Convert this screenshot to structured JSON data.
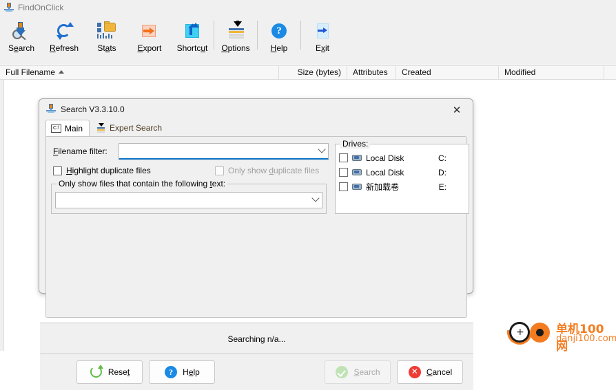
{
  "app": {
    "title": "FindOnClick",
    "icon": "pin-magnifier-icon"
  },
  "toolbar": {
    "items": [
      {
        "label_pre": "S",
        "label_key": "e",
        "label_post": "arch",
        "full": "Search",
        "icon": "search-icon"
      },
      {
        "label_pre": "",
        "label_key": "R",
        "label_post": "efresh",
        "full": "Refresh",
        "icon": "refresh-icon"
      },
      {
        "label_pre": "St",
        "label_key": "a",
        "label_post": "ts",
        "full": "Stats",
        "icon": "stats-icon"
      },
      {
        "label_pre": "",
        "label_key": "E",
        "label_post": "xport",
        "full": "Export",
        "icon": "export-icon"
      },
      {
        "label_pre": "Shortc",
        "label_key": "u",
        "label_post": "t",
        "full": "Shortcut",
        "icon": "shortcut-icon"
      },
      {
        "label_pre": "",
        "label_key": "O",
        "label_post": "ptions",
        "full": "Options",
        "icon": "options-icon"
      },
      {
        "label_pre": "",
        "label_key": "H",
        "label_post": "elp",
        "full": "Help",
        "icon": "help-icon"
      },
      {
        "label_pre": "E",
        "label_key": "x",
        "label_post": "it",
        "full": "Exit",
        "icon": "exit-icon"
      }
    ]
  },
  "list": {
    "columns": [
      {
        "label": "Full Filename",
        "sort": "asc",
        "align": "left"
      },
      {
        "label": "Size (bytes)",
        "sort": "",
        "align": "right"
      },
      {
        "label": "Attributes",
        "sort": "",
        "align": "left"
      },
      {
        "label": "Created",
        "sort": "",
        "align": "left"
      },
      {
        "label": "Modified",
        "sort": "",
        "align": "left"
      }
    ],
    "rows": []
  },
  "dialog": {
    "title": "Search V3.3.10.0",
    "icon": "pin-magnifier-icon",
    "close_label": "✕",
    "tabs": [
      {
        "label": "Main",
        "icon": "drive-letter-icon",
        "icon_text": "C:\\",
        "selected": true
      },
      {
        "label": "Expert Search",
        "icon": "expert-search-icon",
        "selected": false
      }
    ],
    "main": {
      "filename_filter": {
        "label_pre": "",
        "label_key": "F",
        "label_post": "ilename filter:",
        "full_label": "Filename filter:",
        "value": "",
        "placeholder": ""
      },
      "highlight_duplicates": {
        "label_pre": "",
        "label_key": "H",
        "label_post": "ighlight duplicate files",
        "full_label": "Highlight duplicate files",
        "checked": false,
        "disabled": false
      },
      "only_show_duplicates": {
        "label_pre": "Only show ",
        "label_key": "d",
        "label_post": "uplicate files",
        "full_label": "Only show duplicate files",
        "checked": false,
        "disabled": true
      },
      "contains_text": {
        "label_pre": "Only show files that contain the following ",
        "label_key": "t",
        "label_post": "ext:",
        "full_label": "Only show files that contain the following text:",
        "value": "",
        "placeholder": ""
      },
      "drives": {
        "title": "Drives:",
        "items": [
          {
            "name": "Local Disk",
            "letter": "C:",
            "checked": false,
            "icon": "drive-icon"
          },
          {
            "name": "Local Disk",
            "letter": "D:",
            "checked": false,
            "icon": "drive-icon"
          },
          {
            "name": "新加载卷",
            "letter": "E:",
            "checked": false,
            "icon": "drive-icon"
          }
        ]
      }
    },
    "status": "Searching n/a...",
    "buttons": [
      {
        "label_pre": "Rese",
        "label_key": "t",
        "label_post": "",
        "full": "Reset",
        "icon": "refresh-circle-icon",
        "disabled": false
      },
      {
        "label_pre": "H",
        "label_key": "e",
        "label_post": "lp",
        "full": "Help",
        "icon": "help-icon",
        "disabled": false
      },
      {
        "label_pre": "",
        "label_key": "S",
        "label_post": "earch",
        "full": "Search",
        "icon": "check-circle-icon",
        "disabled": true
      },
      {
        "label_pre": "",
        "label_key": "C",
        "label_post": "ancel",
        "full": "Cancel",
        "icon": "cancel-circle-icon",
        "disabled": false
      }
    ]
  },
  "watermark": {
    "line1": "单机100网",
    "line2": "danji100.com",
    "color": "#f47c20"
  },
  "colors": {
    "window_bg": "#f0f0f0",
    "list_bg": "#ffffff",
    "accent": "#0a6fc2",
    "title_text": "#7a7a7a"
  }
}
